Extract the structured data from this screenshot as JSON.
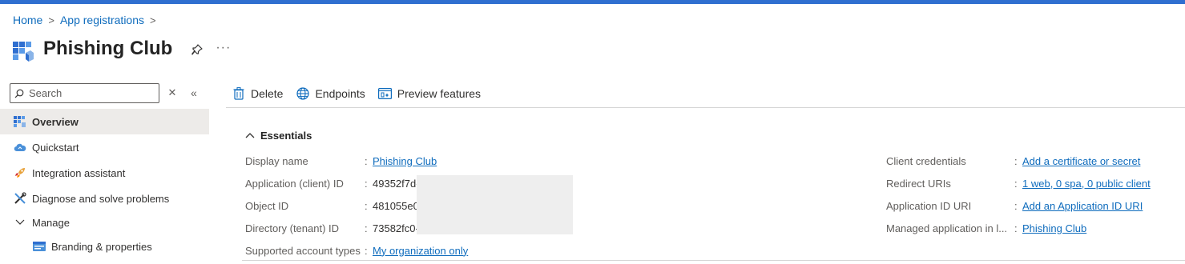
{
  "breadcrumb": {
    "home": "Home",
    "app_registrations": "App registrations",
    "sep": ">"
  },
  "title": "Phishing Club",
  "more": "···",
  "search": {
    "placeholder": "Search"
  },
  "nav": {
    "overview": "Overview",
    "quickstart": "Quickstart",
    "integration": "Integration assistant",
    "diagnose": "Diagnose and solve problems",
    "manage": "Manage",
    "branding": "Branding & properties"
  },
  "toolbar": {
    "delete": "Delete",
    "endpoints": "Endpoints",
    "preview": "Preview features"
  },
  "essentials": {
    "header": "Essentials",
    "left": [
      {
        "label": "Display name",
        "value": "Phishing Club"
      },
      {
        "label": "Application (client) ID",
        "value": "49352f7d-"
      },
      {
        "label": "Object ID",
        "value": "481055e0-"
      },
      {
        "label": "Directory (tenant) ID",
        "value": "73582fc0-"
      },
      {
        "label": "Supported account types",
        "value": "My organization only"
      }
    ],
    "right": [
      {
        "label": "Client credentials",
        "value": "Add a certificate or secret"
      },
      {
        "label": "Redirect URIs",
        "value": "1 web, 0 spa, 0 public client"
      },
      {
        "label": "Application ID URI",
        "value": "Add an Application ID URI"
      },
      {
        "label": "Managed application in l...",
        "value": "Phishing Club"
      }
    ]
  },
  "colors": {
    "accent": "#0f6cbd",
    "topbar": "#2f6fd0"
  }
}
